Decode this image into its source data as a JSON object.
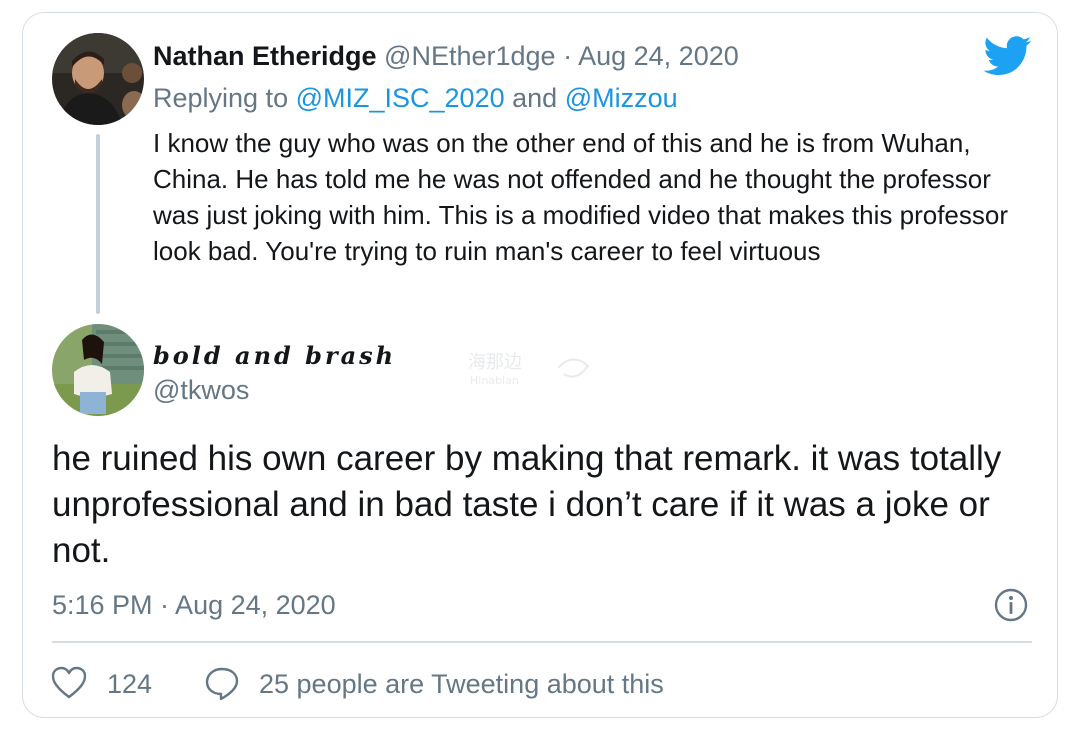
{
  "parent_tweet": {
    "display_name": "Nathan Etheridge",
    "handle": "@NEther1dge",
    "separator": "·",
    "date": "Aug 24, 2020",
    "replying_prefix": "Replying to",
    "replying_to_1": "@MIZ_ISC_2020",
    "replying_and": "and",
    "replying_to_2": "@Mizzou",
    "text": "I know the guy who was on the other end of this and he is from Wuhan, China. He has told me he was not offended and he thought the professor was just joking with him. This is a modified video that makes this professor look bad. You're trying to ruin man's career to feel virtuous"
  },
  "reply_tweet": {
    "display_name": "bold and brash",
    "handle": "@tkwos",
    "text": "he ruined his own career by making that remark. it was totally unprofessional and in bad taste i don’t care if it was a joke or not.",
    "timestamp": "5:16 PM · Aug 24, 2020"
  },
  "footer": {
    "like_count": "124",
    "tweeting_text": "25 people are Tweeting about this"
  },
  "watermark": {
    "text_cn": "海那边",
    "text_en": "Hinabian"
  },
  "icons": {
    "brand": "twitter-bird-icon",
    "info": "info-icon",
    "like": "heart-icon",
    "reply": "speech-bubble-icon"
  },
  "colors": {
    "twitter_blue": "#1da1f2",
    "link": "#1b95e0",
    "muted_text": "#657786",
    "primary_text": "#14171a",
    "border": "#d5dde3",
    "thread_line": "#c4cfd6"
  }
}
